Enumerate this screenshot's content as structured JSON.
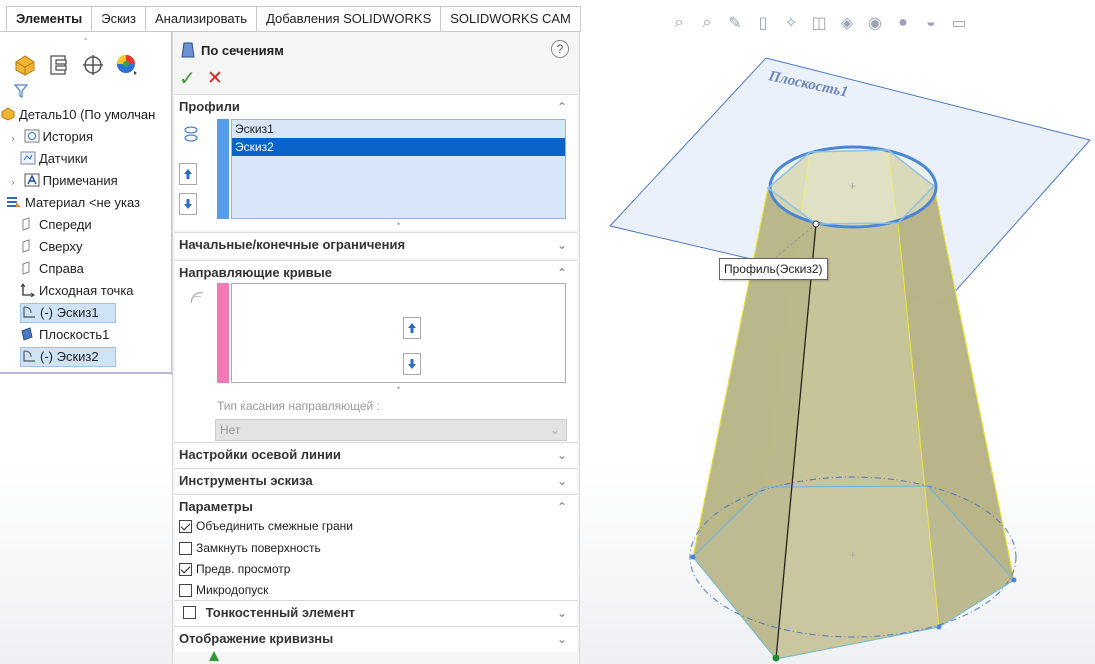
{
  "tabs": [
    "Элементы",
    "Эскиз",
    "Анализировать",
    "Добавления SOLIDWORKS",
    "SOLIDWORKS CAM"
  ],
  "tree": {
    "root": "Деталь10 (По умолчан",
    "items": [
      {
        "label": "История",
        "arrow": "›",
        "icon": "history-icon"
      },
      {
        "label": "Датчики",
        "arrow": "",
        "icon": "sensors-icon"
      },
      {
        "label": "Примечания",
        "arrow": "›",
        "icon": "annotations-icon"
      },
      {
        "label": "Материал <не указ",
        "arrow": "",
        "icon": "material-icon"
      },
      {
        "label": "Спереди",
        "arrow": "",
        "icon": "plane-icon"
      },
      {
        "label": "Сверху",
        "arrow": "",
        "icon": "plane-icon"
      },
      {
        "label": "Справа",
        "arrow": "",
        "icon": "plane-icon"
      },
      {
        "label": "Исходная точка",
        "arrow": "",
        "icon": "origin-icon"
      },
      {
        "label": "(-) Эскиз1",
        "arrow": "",
        "icon": "sketch-icon",
        "selected": true
      },
      {
        "label": "Плоскость1",
        "arrow": "",
        "icon": "plane-filled-icon"
      },
      {
        "label": "(-) Эскиз2",
        "arrow": "",
        "icon": "sketch-icon",
        "selected": true
      }
    ]
  },
  "pm": {
    "title": "По сечениям",
    "help": "?",
    "profiles": {
      "header": "Профили",
      "items": [
        "Эскиз1",
        "Эскиз2"
      ],
      "selected_index": 1
    },
    "start_end": "Начальные/конечные ограничения",
    "guides": {
      "header": "Направляющие кривые",
      "tangency_label": "Тип касания направляющей :",
      "tangency_value": "Нет"
    },
    "centerline": "Настройки осевой линии",
    "sketch_tools": "Инструменты эскиза",
    "options": {
      "header": "Параметры",
      "merge": "Объединить смежные грани",
      "close": "Замкнуть поверхность",
      "preview": "Предв. просмотр",
      "micro": "Микродопуск",
      "merge_checked": true,
      "close_checked": false,
      "preview_checked": true,
      "micro_checked": false
    },
    "thin": "Тонкостенный элемент",
    "curvature": "Отображение кривизны"
  },
  "graphics": {
    "plane_label": "Плоскость1",
    "tooltip": "Профиль(Эскиз2)"
  },
  "colors": {
    "accent": "#0a63c9",
    "loft_fill": "#c8c39a",
    "plane": "#4a78c2",
    "ok": "#3a9a2b",
    "cancel": "#dd2222"
  }
}
